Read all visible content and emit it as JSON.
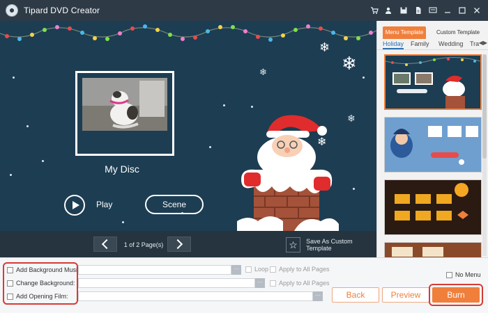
{
  "app": {
    "title": "Tipard DVD Creator"
  },
  "title_icons": [
    "cart-icon",
    "user-key-icon",
    "save-icon",
    "document-icon",
    "chat-icon",
    "minimize-icon",
    "maximize-icon",
    "close-icon"
  ],
  "preview": {
    "disc_title": "My Disc",
    "play_label": "Play",
    "scene_label": "Scene"
  },
  "pager": {
    "page_text": "1 of 2 Page(s)",
    "save_template_label": "Save As Custom Template"
  },
  "templates": {
    "tabs": [
      "Menu Template",
      "Custom Template"
    ],
    "active_tab": "Menu Template",
    "categories": [
      "Holiday",
      "Family",
      "Wedding",
      "Tra"
    ],
    "active_category": "Holiday"
  },
  "options": {
    "background_music_label": "Add Background Music:",
    "change_background_label": "Change Background:",
    "opening_film_label": "Add Opening Film:",
    "loop_label": "Loop",
    "apply_all_label": "Apply to All Pages",
    "browse_label": "···",
    "no_menu_label": "No Menu"
  },
  "actions": {
    "back": "Back",
    "preview": "Preview",
    "burn": "Burn"
  },
  "colors": {
    "accent": "#f07f3c",
    "highlight": "#d83a35",
    "preview_bg": "#1d3d52",
    "titlebar": "#2e3b47"
  }
}
